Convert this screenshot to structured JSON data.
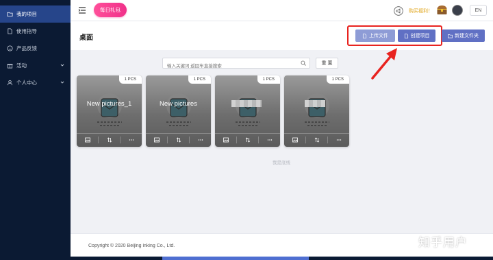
{
  "sidebar": {
    "items": [
      {
        "label": "我的项目",
        "icon": "folder-icon",
        "active": true
      },
      {
        "label": "使用指导",
        "icon": "document-icon",
        "active": false
      },
      {
        "label": "产品反馈",
        "icon": "smile-icon",
        "active": false
      },
      {
        "label": "活动",
        "icon": "gift-icon",
        "active": false,
        "expandable": true
      },
      {
        "label": "个人中心",
        "icon": "user-icon",
        "active": false,
        "expandable": true
      }
    ]
  },
  "topbar": {
    "gift_label": "每日礼包",
    "promo_text": "购买福利！",
    "lang_label": "EN"
  },
  "header": {
    "title": "桌面",
    "upload_label": "上传文件",
    "create_label": "创建项目",
    "new_folder_label": "新建文件夹"
  },
  "search": {
    "placeholder": "输入关键词 返回车直接搜索",
    "reset_label": "重 置"
  },
  "cards": [
    {
      "title": "New pictures_1",
      "count": "1 PCS"
    },
    {
      "title": "New pictures",
      "count": "1 PCS"
    },
    {
      "title": "",
      "count": "1 PCS"
    },
    {
      "title": "",
      "count": "1 PCS"
    }
  ],
  "list_end_text": "我是底线",
  "footer": {
    "copyright": "Copyright © 2020 Beijing inking Co., Ltd."
  },
  "watermark": "知乎用户",
  "colors": {
    "sidebar_bg": "#0b1a33",
    "sidebar_active": "#26458a",
    "accent": "#6070c4",
    "gift_pink": "#f0318a",
    "highlight_red": "#e8231f"
  }
}
